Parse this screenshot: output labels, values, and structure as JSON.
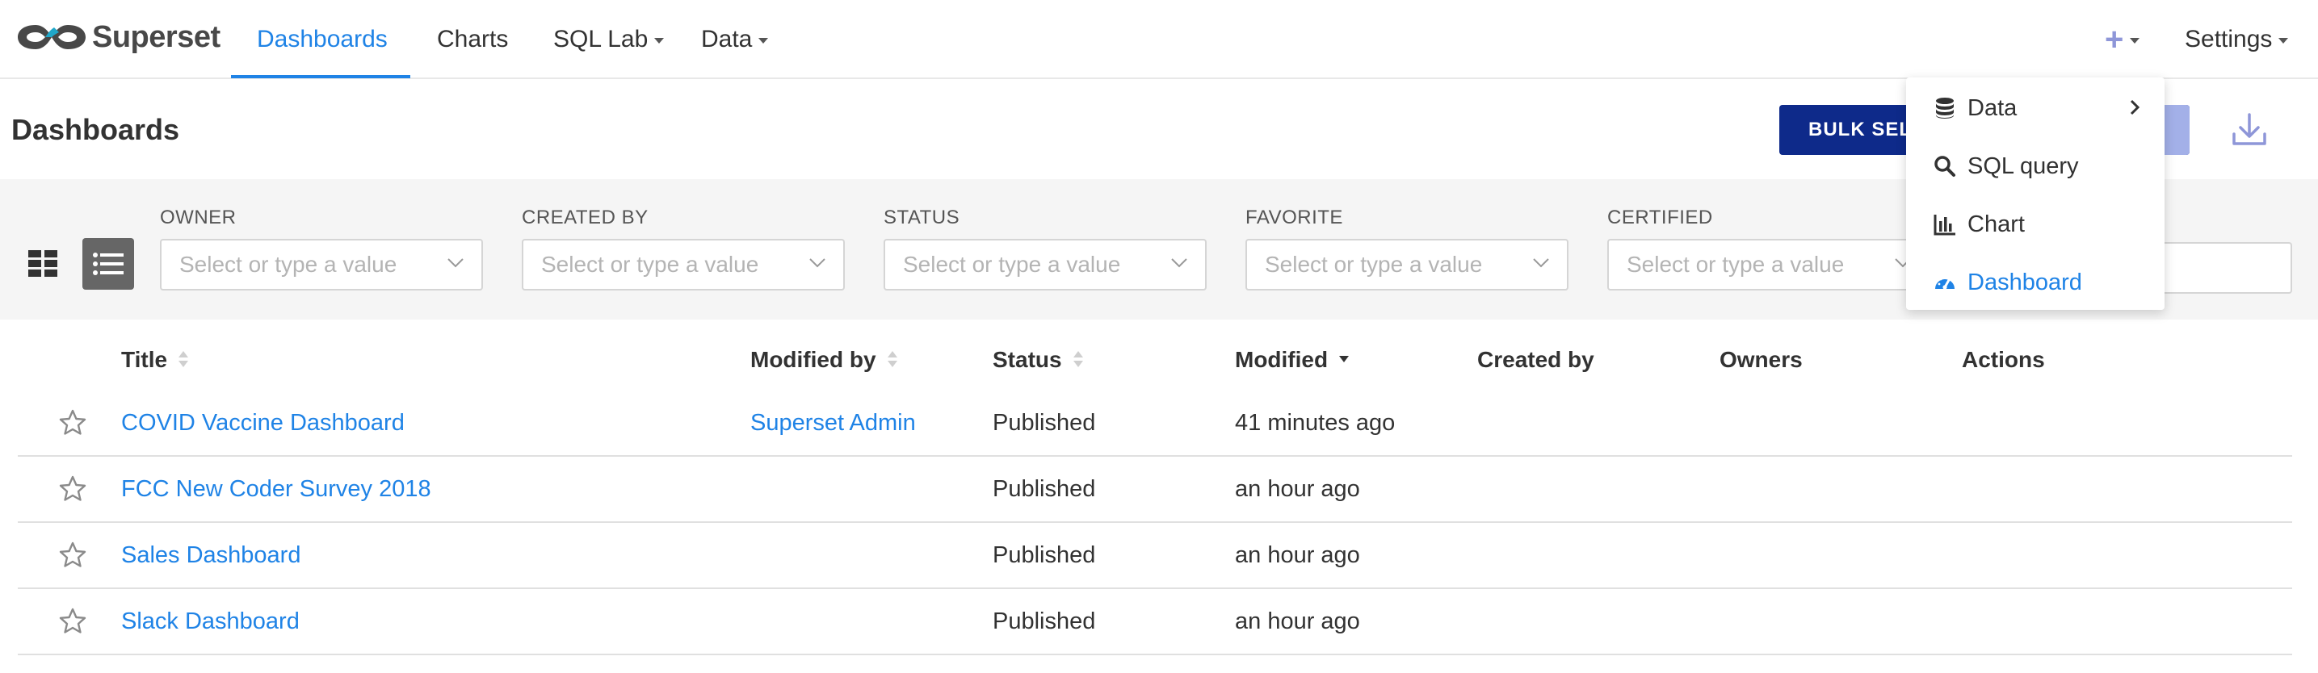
{
  "navbar": {
    "brand": "Superset",
    "items": [
      {
        "label": "Dashboards",
        "active": true
      },
      {
        "label": "Charts"
      },
      {
        "label": "SQL Lab",
        "has_caret": true
      },
      {
        "label": "Data",
        "has_caret": true
      }
    ],
    "plus_icon": "plus-icon",
    "settings_label": "Settings"
  },
  "page": {
    "title": "Dashboards",
    "bulk_select_label": "BULK SELE",
    "download_icon": "download-icon",
    "view_toggle": [
      "card-view-icon",
      "list-view-icon"
    ]
  },
  "filters": [
    {
      "label": "OWNER",
      "placeholder": "Select or type a value"
    },
    {
      "label": "CREATED BY",
      "placeholder": "Select or type a value"
    },
    {
      "label": "STATUS",
      "placeholder": "Select or type a value"
    },
    {
      "label": "FAVORITE",
      "placeholder": "Select or type a value"
    },
    {
      "label": "CERTIFIED",
      "placeholder": "Select or type a value"
    }
  ],
  "table": {
    "columns": [
      "Title",
      "Modified by",
      "Status",
      "Modified",
      "Created by",
      "Owners",
      "Actions"
    ],
    "rows": [
      {
        "title": "COVID Vaccine Dashboard",
        "modified_by": "Superset Admin",
        "status": "Published",
        "modified": "41 minutes ago"
      },
      {
        "title": "FCC New Coder Survey 2018",
        "modified_by": "",
        "status": "Published",
        "modified": "an hour ago"
      },
      {
        "title": "Sales Dashboard",
        "modified_by": "",
        "status": "Published",
        "modified": "an hour ago"
      },
      {
        "title": "Slack Dashboard",
        "modified_by": "",
        "status": "Published",
        "modified": "an hour ago"
      }
    ]
  },
  "new_menu": {
    "items": [
      {
        "label": "Data",
        "icon": "database-icon",
        "submenu": true
      },
      {
        "label": "SQL query",
        "icon": "search-icon"
      },
      {
        "label": "Chart",
        "icon": "bar-chart-icon"
      },
      {
        "label": "Dashboard",
        "icon": "dashboard-gauge-icon",
        "active": true
      }
    ]
  },
  "colors": {
    "primary": "#1f83e6",
    "bulk_button": "#0e2a8a",
    "plus_accent": "#8e96d8",
    "filter_bg": "#f5f5f5"
  }
}
